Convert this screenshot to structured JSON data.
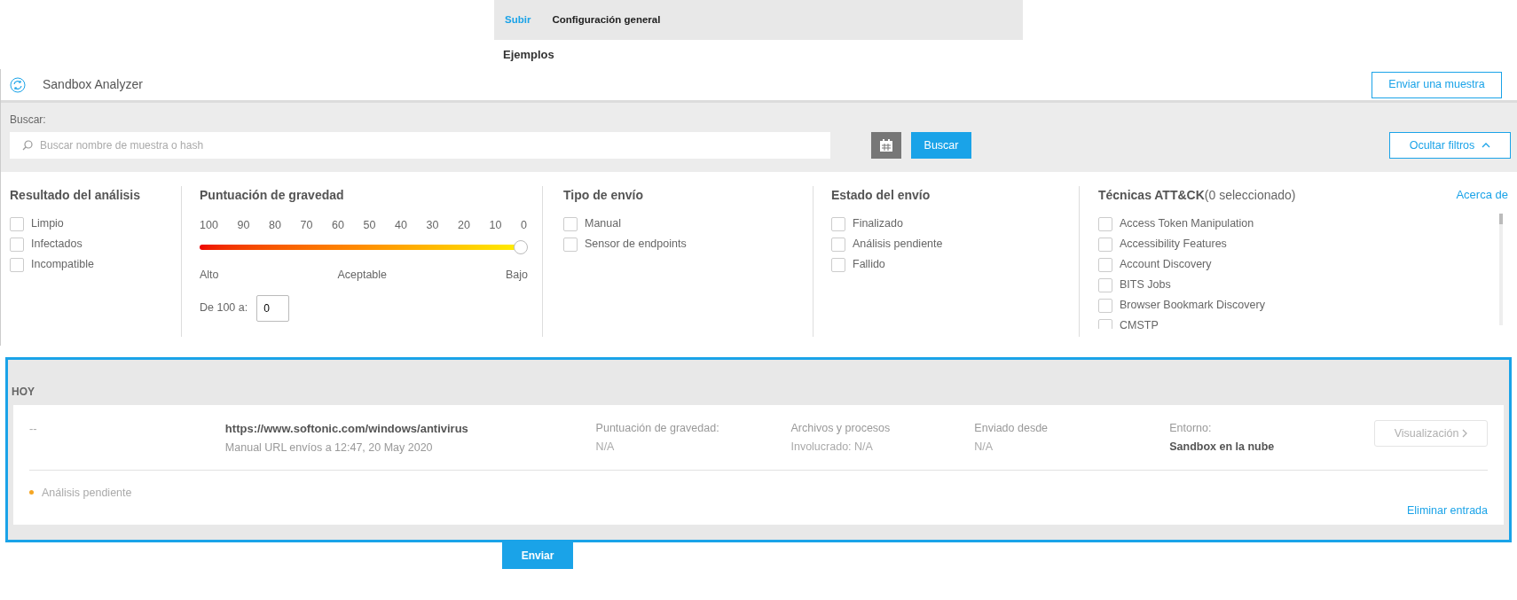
{
  "top_tabs": [
    {
      "label": "Subir",
      "selected": true
    },
    {
      "label": "Configuración general",
      "selected": false
    }
  ],
  "section_title": "Ejemplos",
  "header": {
    "title": "Sandbox Analyzer",
    "send_button": "Enviar una muestra"
  },
  "search": {
    "label": "Buscar:",
    "placeholder": "Buscar nombre de muestra o hash",
    "button": "Buscar",
    "filters_button": "Ocultar filtros"
  },
  "filters": {
    "analysis_result": {
      "title": "Resultado del análisis",
      "options": [
        {
          "label": "Limpio",
          "checked": false
        },
        {
          "label": "Infectados",
          "checked": false
        },
        {
          "label": "Incompatible",
          "checked": false
        }
      ]
    },
    "severity": {
      "title": "Puntuación de gravedad",
      "ticks": [
        "100",
        "90",
        "80",
        "70",
        "60",
        "50",
        "40",
        "30",
        "20",
        "10",
        "0"
      ],
      "level": 1,
      "labels": [
        "Alto",
        "Aceptable",
        "Bajo"
      ],
      "range_label": "De 100 a:",
      "range_value": "0"
    },
    "submission_type": {
      "title": "Tipo de envío",
      "options": [
        {
          "label": "Manual",
          "checked": false
        },
        {
          "label": "Sensor de endpoints",
          "checked": false
        }
      ]
    },
    "submission_state": {
      "title": "Estado del envío",
      "options": [
        {
          "label": "Finalizado",
          "checked": false
        },
        {
          "label": "Análisis pendiente",
          "checked": false
        },
        {
          "label": "Fallido",
          "checked": false
        }
      ]
    },
    "attck": {
      "title": "Técnicas ATT&CK",
      "count": "(0 seleccionado)",
      "link": "Acerca de",
      "options": [
        {
          "label": "Access Token Manipulation",
          "checked": false
        },
        {
          "label": "Accessibility Features",
          "checked": false
        },
        {
          "label": "Account Discovery",
          "checked": false
        },
        {
          "label": "BITS Jobs",
          "checked": false
        },
        {
          "label": "Browser Bookmark Discovery",
          "checked": false
        },
        {
          "label": "CMSTP",
          "checked": false
        }
      ]
    }
  },
  "results": {
    "group": "HOY",
    "entries": [
      {
        "id_text": "--",
        "url": "https://www.softonic.com/windows/antivirus",
        "subtitle": "Manual URL envíos a 12:47, 20 May 2020",
        "fields": [
          {
            "label": "Puntuación de gravedad:",
            "value": "N/A",
            "bold": false
          },
          {
            "label": "Archivos y procesos",
            "value": "Involucrado: N/A",
            "bold": false
          },
          {
            "label": "Enviado desde",
            "value": "N/A",
            "bold": false
          },
          {
            "label": "Entorno:",
            "value": "Sandbox en la nube",
            "bold": true
          }
        ],
        "view_button": "Visualización",
        "view_disabled": true,
        "status": "Análisis pendiente",
        "color": "#f5a623",
        "delete_link": "Eliminar entrada"
      }
    ]
  },
  "submit_button": "Enviar"
}
